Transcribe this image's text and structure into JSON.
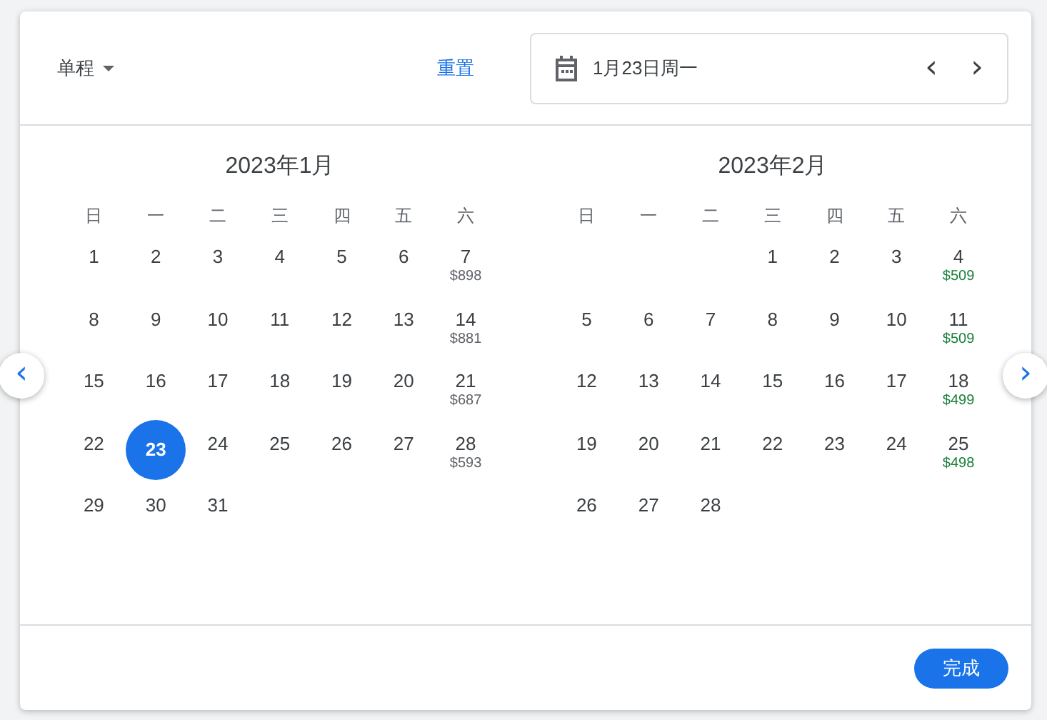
{
  "trip_type": {
    "label": "单程"
  },
  "reset": "重置",
  "date_field": {
    "value": "1月23日周一",
    "prev": "‹",
    "next": "›"
  },
  "nav": {
    "prev": "‹",
    "next": "›"
  },
  "months": [
    {
      "title": "2023年1月",
      "weekdays": [
        "日",
        "一",
        "二",
        "三",
        "四",
        "五",
        "六"
      ],
      "weeks": [
        [
          {
            "day": "1",
            "selected": false
          },
          {
            "day": "2",
            "selected": false
          },
          {
            "day": "3",
            "selected": false
          },
          {
            "day": "4",
            "selected": false
          },
          {
            "day": "5",
            "selected": false
          },
          {
            "day": "6",
            "selected": false
          },
          {
            "day": "7",
            "selected": false,
            "price": "$898",
            "color": "#5f6368"
          }
        ],
        [
          {
            "day": "8",
            "selected": false
          },
          {
            "day": "9",
            "selected": false
          },
          {
            "day": "10",
            "selected": false
          },
          {
            "day": "11",
            "selected": false
          },
          {
            "day": "12",
            "selected": false
          },
          {
            "day": "13",
            "selected": false
          },
          {
            "day": "14",
            "selected": false,
            "price": "$881",
            "color": "#5f6368"
          }
        ],
        [
          {
            "day": "15",
            "selected": false
          },
          {
            "day": "16",
            "selected": false
          },
          {
            "day": "17",
            "selected": false
          },
          {
            "day": "18",
            "selected": false
          },
          {
            "day": "19",
            "selected": false
          },
          {
            "day": "20",
            "selected": false
          },
          {
            "day": "21",
            "selected": false,
            "price": "$687",
            "color": "#5f6368"
          }
        ],
        [
          {
            "day": "22",
            "selected": false
          },
          {
            "day": "23",
            "selected": true
          },
          {
            "day": "24",
            "selected": false
          },
          {
            "day": "25",
            "selected": false
          },
          {
            "day": "26",
            "selected": false
          },
          {
            "day": "27",
            "selected": false
          },
          {
            "day": "28",
            "selected": false,
            "price": "$593",
            "color": "#5f6368"
          }
        ],
        [
          {
            "day": "29",
            "selected": false
          },
          {
            "day": "30",
            "selected": false
          },
          {
            "day": "31",
            "selected": false
          }
        ]
      ]
    },
    {
      "title": "2023年2月",
      "weekdays": [
        "日",
        "一",
        "二",
        "三",
        "四",
        "五",
        "六"
      ],
      "weeks": [
        [
          {
            "day": "1",
            "selected": false
          },
          {
            "day": "2",
            "selected": false
          },
          {
            "day": "3",
            "selected": false
          },
          {
            "day": "4",
            "selected": false,
            "price": "$509",
            "color": "#188038"
          }
        ],
        [
          {
            "day": "5",
            "selected": false
          },
          {
            "day": "6",
            "selected": false
          },
          {
            "day": "7",
            "selected": false
          },
          {
            "day": "8",
            "selected": false
          },
          {
            "day": "9",
            "selected": false
          },
          {
            "day": "10",
            "selected": false
          },
          {
            "day": "11",
            "selected": false,
            "price": "$509",
            "color": "#188038"
          }
        ],
        [
          {
            "day": "12",
            "selected": false
          },
          {
            "day": "13",
            "selected": false
          },
          {
            "day": "14",
            "selected": false
          },
          {
            "day": "15",
            "selected": false
          },
          {
            "day": "16",
            "selected": false
          },
          {
            "day": "17",
            "selected": false
          },
          {
            "day": "18",
            "selected": false,
            "price": "$499",
            "color": "#188038"
          }
        ],
        [
          {
            "day": "19",
            "selected": false
          },
          {
            "day": "20",
            "selected": false
          },
          {
            "day": "21",
            "selected": false
          },
          {
            "day": "22",
            "selected": false
          },
          {
            "day": "23",
            "selected": false
          },
          {
            "day": "24",
            "selected": false
          },
          {
            "day": "25",
            "selected": false,
            "price": "$498",
            "color": "#188038"
          }
        ],
        [
          {
            "day": "26",
            "selected": false
          },
          {
            "day": "27",
            "selected": false
          },
          {
            "day": "28",
            "selected": false
          }
        ]
      ]
    }
  ],
  "done": "完成"
}
